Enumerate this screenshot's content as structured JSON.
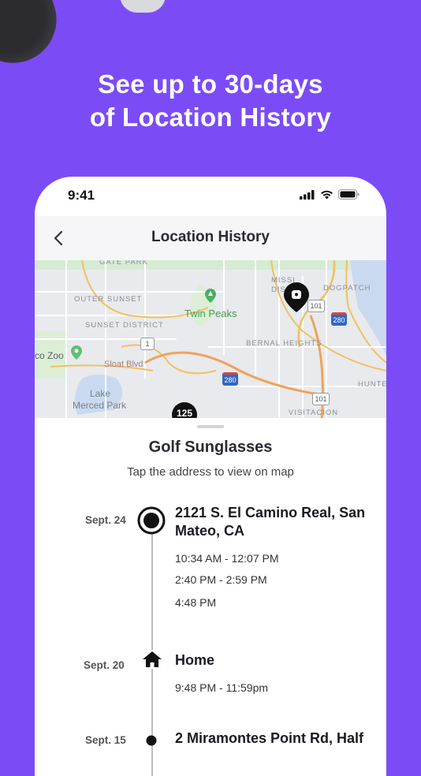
{
  "headline": {
    "line1": "See up to 30-days",
    "line2": "of Location History"
  },
  "status_bar": {
    "time": "9:41"
  },
  "nav": {
    "title": "Location History"
  },
  "map": {
    "labels": {
      "gate_park": "Gate Park",
      "outer_sunset": "OUTER SUNSET",
      "sunset_district": "SUNSET DISTRICT",
      "twin_peaks": "Twin Peaks",
      "mission": "MISSI",
      "mission2": "DIS",
      "dogpatch": "DOGPATCH",
      "bernal_heights": "BERNAL HEIGHTS",
      "zoo": "co Zoo",
      "sloat_blvd": "Sloat Blvd",
      "lake_merced": "Lake",
      "lake_merced2": "Merced Park",
      "hunters": "HUNTE",
      "visitacion": "VISITACION"
    },
    "shields": {
      "s1": "1",
      "s101a": "101",
      "s280a": "280",
      "s280b": "280",
      "s101b": "101"
    },
    "cluster_count": "125"
  },
  "sheet": {
    "device_name": "Golf Sunglasses",
    "hint": "Tap the address to view on map",
    "entries": [
      {
        "date": "Sept. 24",
        "title_line1": "2121 S. El Camino Real, San",
        "title_line2": "Mateo, CA",
        "times": [
          "10:34 AM - 12:07 PM",
          "2:40 PM - 2:59 PM",
          "4:48 PM"
        ],
        "icon": "current-location-icon"
      },
      {
        "date": "Sept. 20",
        "title_line1": "Home",
        "times": [
          "9:48 PM - 11:59pm"
        ],
        "icon": "home-icon"
      },
      {
        "date": "Sept. 15",
        "title_line1": "2 Miramontes Point Rd, Half",
        "icon": "dot-icon"
      }
    ]
  },
  "colors": {
    "background": "#7b4cf6",
    "map_accent": "#f2c15b",
    "highway": "#f0a25a"
  }
}
